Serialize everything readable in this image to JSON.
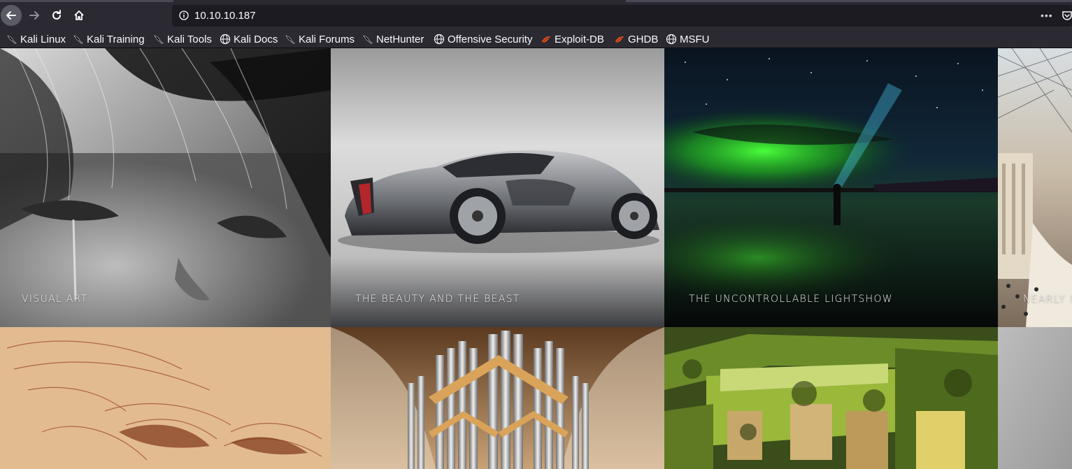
{
  "browser": {
    "url": "10.10.10.187",
    "more_menu": "•••",
    "bookmarks": [
      {
        "label": "Kali Linux",
        "icon": "kali-dragon-icon"
      },
      {
        "label": "Kali Training",
        "icon": "kali-dragon-icon"
      },
      {
        "label": "Kali Tools",
        "icon": "kali-dragon-icon"
      },
      {
        "label": "Kali Docs",
        "icon": "globe-icon"
      },
      {
        "label": "Kali Forums",
        "icon": "kali-dragon-icon"
      },
      {
        "label": "NetHunter",
        "icon": "kali-dragon-icon"
      },
      {
        "label": "Offensive Security",
        "icon": "globe-icon"
      },
      {
        "label": "Exploit-DB",
        "icon": "exploit-db-icon"
      },
      {
        "label": "GHDB",
        "icon": "exploit-db-icon"
      },
      {
        "label": "MSFU",
        "icon": "globe-icon"
      }
    ]
  },
  "gallery": {
    "tiles": [
      {
        "caption": "VISUAL ART"
      },
      {
        "caption": "THE BEAUTY AND THE BEAST"
      },
      {
        "caption": "THE UNCONTROLLABLE LIGHTSHOW"
      },
      {
        "caption": "NEARLY M"
      },
      {
        "caption": ""
      },
      {
        "caption": ""
      },
      {
        "caption": ""
      },
      {
        "caption": ""
      }
    ]
  },
  "colors": {
    "chrome": "#2b2a33",
    "urlbar": "#1c1b22",
    "text": "#fbfbfe",
    "exploit_db_accent": "#e8541e"
  }
}
